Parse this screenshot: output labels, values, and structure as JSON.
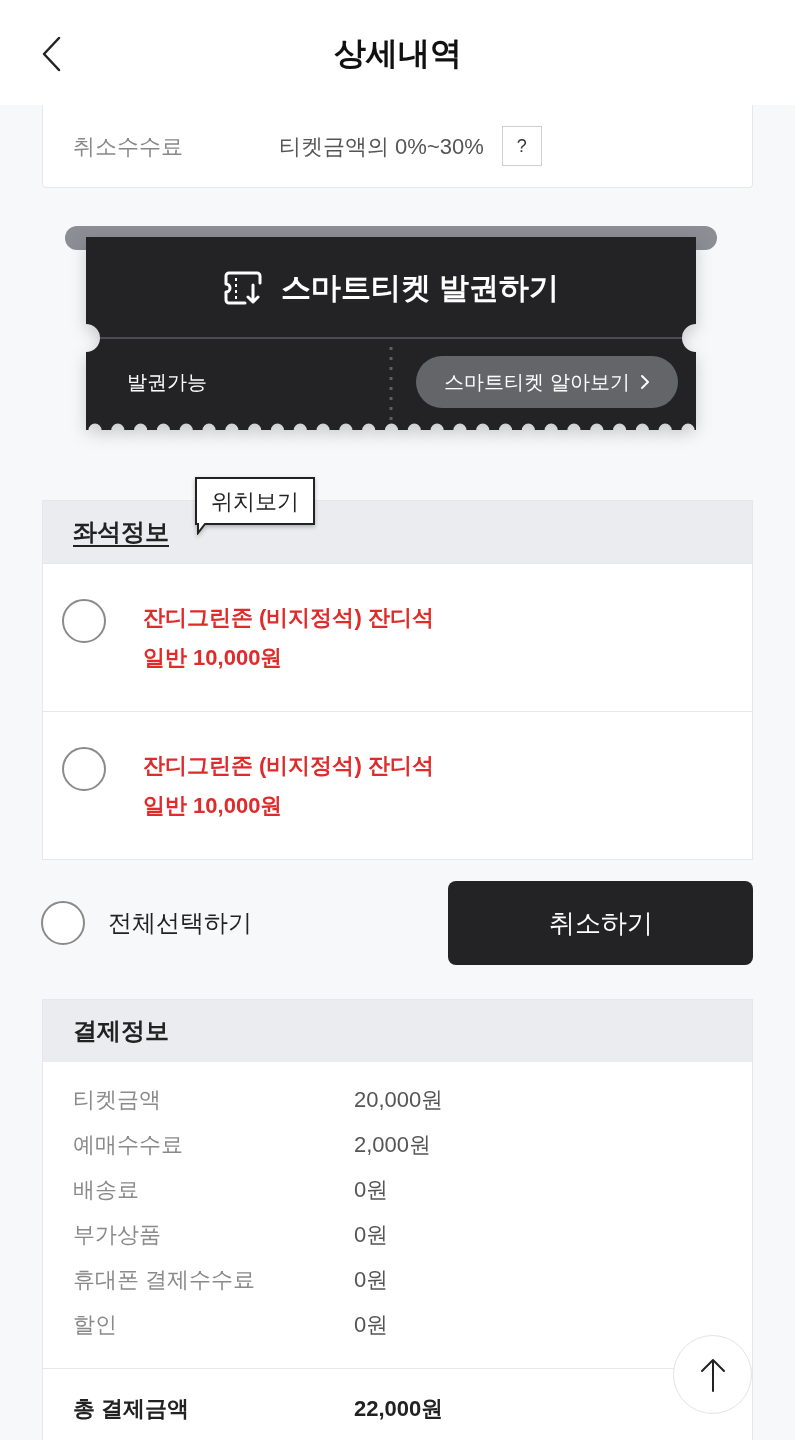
{
  "header": {
    "title": "상세내역"
  },
  "cancel_info": {
    "rows": [
      {
        "label": "취소수수료",
        "value": "티켓금액의 0%~30%",
        "help": "?"
      }
    ]
  },
  "smart_ticket": {
    "title": "스마트티켓 발권하기",
    "status": "발권가능",
    "button": "스마트티켓 알아보기"
  },
  "seat_info": {
    "title": "좌석정보",
    "tooltip": "위치보기",
    "seats": [
      {
        "zone": "잔디그린존 (비지정석) 잔디석",
        "price": "일반 10,000원",
        "selected": false
      },
      {
        "zone": "잔디그린존 (비지정석) 잔디석",
        "price": "일반 10,000원",
        "selected": false
      }
    ]
  },
  "select_all": {
    "label": "전체선택하기",
    "checked": false
  },
  "cancel_button": "취소하기",
  "payment_info": {
    "title": "결제정보",
    "rows": [
      {
        "label": "티켓금액",
        "value": "20,000원"
      },
      {
        "label": "예매수수료",
        "value": "2,000원"
      },
      {
        "label": "배송료",
        "value": "0원"
      },
      {
        "label": "부가상품",
        "value": "0원"
      },
      {
        "label": "휴대폰 결제수수료",
        "value": "0원"
      },
      {
        "label": "할인",
        "value": "0원"
      }
    ],
    "total": {
      "label": "총 결제금액",
      "value": "22,000원"
    }
  }
}
